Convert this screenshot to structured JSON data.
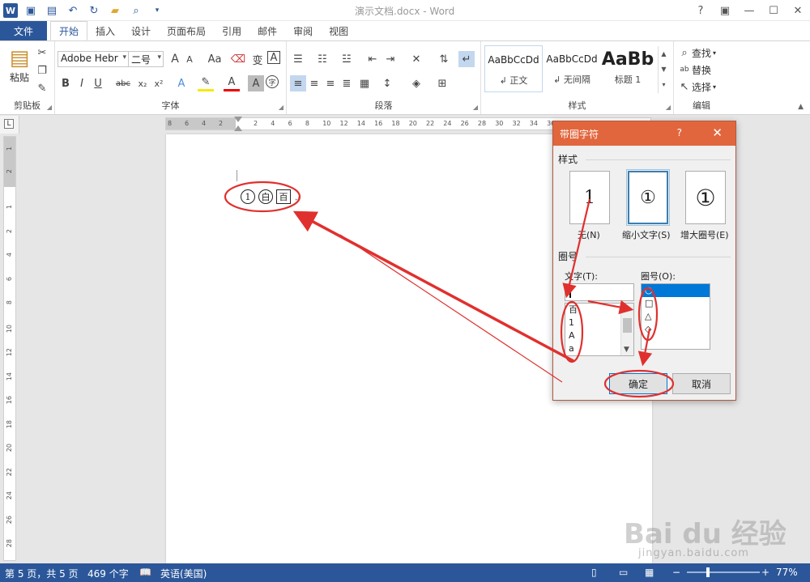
{
  "window": {
    "title": "演示文档.docx - Word",
    "controls": [
      "?",
      "▣",
      "—",
      "☐",
      "✕"
    ]
  },
  "qat_icons": [
    "word-logo-icon",
    "save-icon",
    "save-as-icon",
    "undo-icon",
    "redo-icon",
    "open-icon",
    "print-preview-icon",
    "customize-icon"
  ],
  "tabs": {
    "file": "文件",
    "items": [
      "开始",
      "插入",
      "设计",
      "页面布局",
      "引用",
      "邮件",
      "审阅",
      "视图"
    ],
    "active_index": 0
  },
  "ribbon": {
    "clipboard": {
      "label": "剪贴板",
      "paste": "粘贴"
    },
    "font": {
      "label": "字体",
      "font_name": "Adobe Hebr",
      "font_size": "二号",
      "grow": "A",
      "shrink": "A",
      "case": "Aa",
      "phonetic": "变",
      "border_char": "A",
      "bold": "B",
      "italic": "I",
      "underline": "U",
      "strike": "abc",
      "subscript": "x₂",
      "superscript": "x²",
      "font_color": "A",
      "shading": "A",
      "enclose": "字"
    },
    "paragraph": {
      "label": "段落"
    },
    "styles": {
      "label": "样式",
      "items": [
        {
          "sample": "AaBbCcDd",
          "name": "↲ 正文"
        },
        {
          "sample": "AaBbCcDd",
          "name": "↲ 无间隔"
        },
        {
          "sample": "AaBb",
          "name": "标题 1"
        }
      ]
    },
    "editing": {
      "label": "编辑",
      "find": "查找",
      "replace": "替换",
      "select": "选择"
    }
  },
  "ruler": {
    "h_numbers": [
      "8",
      "6",
      "4",
      "2",
      "2",
      "4",
      "6",
      "8",
      "10",
      "12",
      "14",
      "16",
      "18",
      "20",
      "22",
      "24",
      "26",
      "28",
      "30",
      "32",
      "34",
      "36"
    ],
    "v_numbers": [
      "1",
      "2",
      "1",
      "2",
      "4",
      "6",
      "8",
      "10",
      "12",
      "14",
      "16",
      "18",
      "20",
      "22",
      "24",
      "26",
      "28"
    ]
  },
  "document": {
    "enclosed_chars": [
      "1",
      "白",
      "百"
    ],
    "paragraph_mark": "↵"
  },
  "dialog": {
    "title": "带圈字符",
    "help": "?",
    "close": "✕",
    "style_label": "样式",
    "styles": [
      {
        "glyph": "1",
        "label": "无(N)"
      },
      {
        "glyph": "①",
        "label": "缩小文字(S)"
      },
      {
        "glyph": "①",
        "label": "增大圈号(E)"
      }
    ],
    "circle_section": "圈号",
    "text_label": "文字(T):",
    "text_value": "",
    "text_list": [
      "百",
      "1",
      "A",
      "a"
    ],
    "enclosure_label": "圈号(O):",
    "enclosure_list": [
      "○",
      "□",
      "△",
      "◇"
    ],
    "ok": "确定",
    "cancel": "取消"
  },
  "statusbar": {
    "page": "第 5 页，共 5 页",
    "words": "469 个字",
    "language": "英语(美国)",
    "zoom": "77%"
  },
  "watermark": {
    "brand": "Bai du 经验",
    "url": "jingyan.baidu.com"
  },
  "colors": {
    "word_blue": "#2b579a",
    "dialog_title": "#e2663d",
    "annotation_red": "#e0302e",
    "selection_blue": "#0078d7"
  }
}
